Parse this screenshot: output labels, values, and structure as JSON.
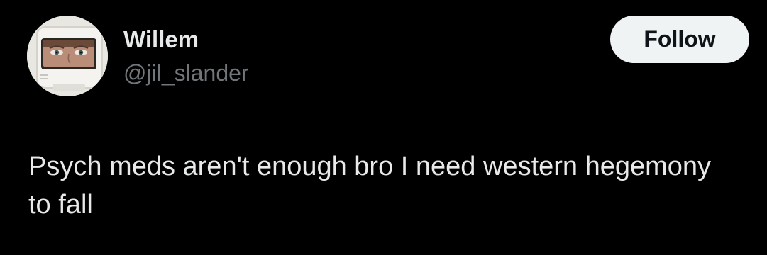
{
  "tweet": {
    "author": {
      "name": "Willem",
      "handle": "@jil_slander"
    },
    "follow_label": "Follow",
    "text": "Psych meds aren't enough bro I need western hegemony to fall"
  },
  "colors": {
    "background": "#000000",
    "primary_text": "#e7e9ea",
    "secondary_text": "#71767b",
    "button_bg": "#eff3f4",
    "button_text": "#0f1419"
  }
}
